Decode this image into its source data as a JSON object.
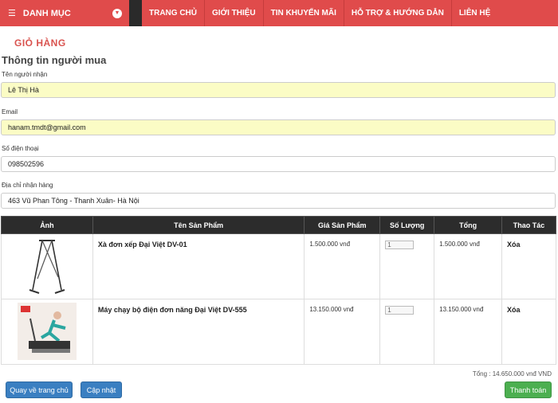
{
  "nav": {
    "category_label": "DANH MỤC",
    "items": [
      "TRANG CHỦ",
      "GIỚI THIỆU",
      "TIN KHUYẾN MÃI",
      "HỖ TRỢ & HƯỚNG DẪN",
      "LIÊN HỆ"
    ]
  },
  "cart_title": "GIỎ HÀNG",
  "buyer": {
    "section_title": "Thông tin người mua",
    "name_label": "Tên người nhận",
    "name_value": "Lê Thị Hà",
    "email_label": "Email",
    "email_value": "hanam.tmdt@gmail.com",
    "phone_label": "Số điện thoại",
    "phone_value": "098502596",
    "address_label": "Địa chỉ nhận hàng",
    "address_value": "463 Vũ Phan Tông - Thanh Xuân- Hà Nội"
  },
  "table": {
    "headers": [
      "Ảnh",
      "Tên Sản Phẩm",
      "Giá Sản Phẩm",
      "Số Lượng",
      "Tổng",
      "Thao Tác"
    ],
    "rows": [
      {
        "name": "Xà đơn xếp Đại Việt DV-01",
        "price": "1.500.000 vnđ",
        "qty": "1",
        "total": "1.500.000 vnđ",
        "action": "Xóa"
      },
      {
        "name": "Máy chạy bộ điện đơn năng Đại Việt DV-555",
        "price": "13.150.000 vnđ",
        "qty": "1",
        "total": "13.150.000 vnđ",
        "action": "Xóa"
      }
    ]
  },
  "total_text": "Tổng : 14.650.000 vnđ VND",
  "buttons": {
    "home": "Quay về trang chủ",
    "update": "Cập nhật",
    "checkout": "Thanh toán"
  },
  "colors": {
    "brand_red": "#e04b4b",
    "table_header": "#2c2c2c",
    "button_blue": "#3a7fc1",
    "button_green": "#4caf50",
    "autofill_yellow": "#fbfcc5"
  }
}
